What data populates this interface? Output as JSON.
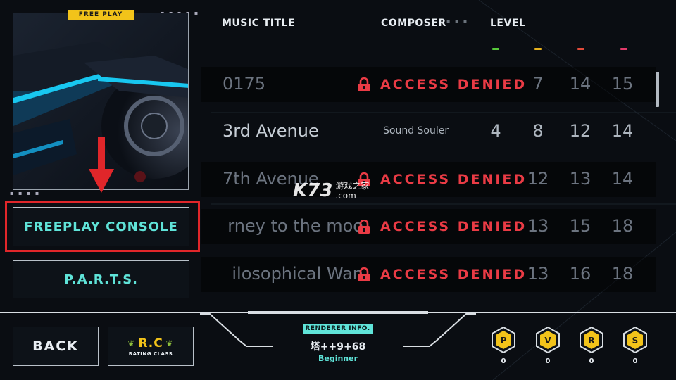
{
  "jacket": {
    "badge": "FREE PLAY"
  },
  "menu": {
    "freeplay_console": "FREEPLAY CONSOLE",
    "parts": "P.A.R.T.S."
  },
  "header": {
    "music_title": "MUSIC TITLE",
    "composer": "COMPOSER",
    "level": "LEVEL",
    "difficulty_colors": [
      "#57c93a",
      "#e7b21f",
      "#e24a3a",
      "#e23a6a"
    ]
  },
  "songs": [
    {
      "title": "0175",
      "locked": true,
      "status": "ACCESS DENIED",
      "levels": [
        "",
        "7",
        "14",
        "15"
      ]
    },
    {
      "title": "3rd Avenue",
      "locked": false,
      "composer": "Sound Souler",
      "levels": [
        "4",
        "8",
        "12",
        "14"
      ]
    },
    {
      "title": "7th Avenue",
      "locked": true,
      "status": "ACCESS DENIED",
      "levels": [
        "",
        "12",
        "13",
        "14"
      ]
    },
    {
      "title": "rney to the moo",
      "locked": true,
      "status": "ACCESS DENIED",
      "levels": [
        "",
        "13",
        "15",
        "18"
      ]
    },
    {
      "title": "ilosophical Wan",
      "locked": true,
      "status": "ACCESS DENIED",
      "levels": [
        "",
        "13",
        "16",
        "18"
      ]
    }
  ],
  "watermark": {
    "logo": "K73",
    "text_top": "游戏之家",
    "text_bottom": ".com"
  },
  "bottom": {
    "back": "BACK",
    "rc_main": "R.C",
    "rc_sub": "RATING CLASS",
    "renderer_label": "RENDERER INFO.",
    "renderer_name": "塔++9+68",
    "renderer_rank": "Beginner",
    "stats": [
      {
        "letter": "P",
        "count": "0"
      },
      {
        "letter": "V",
        "count": "0"
      },
      {
        "letter": "R",
        "count": "0"
      },
      {
        "letter": "S",
        "count": "0"
      }
    ]
  }
}
